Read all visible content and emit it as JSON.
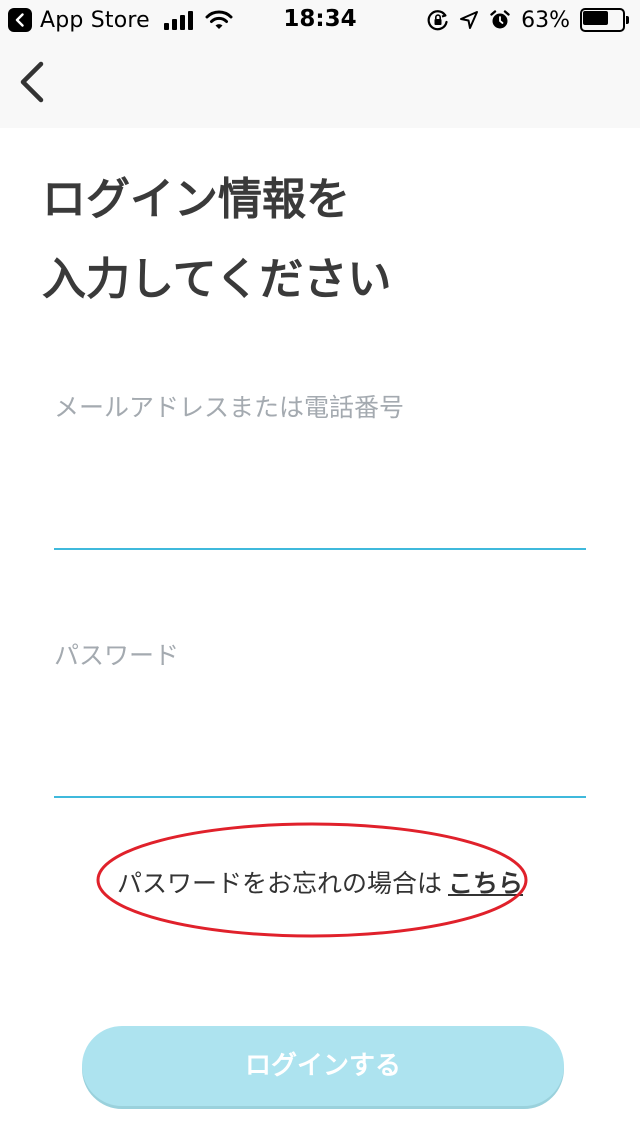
{
  "status_bar": {
    "back_app": "App Store",
    "time": "18:34",
    "battery_percent": "63%",
    "battery_level": 0.63
  },
  "nav": {
    "back_icon": "chevron-left-icon"
  },
  "heading": {
    "line1": "ログイン情報を",
    "line2": "入力してください"
  },
  "form": {
    "email": {
      "label": "メールアドレスまたは電話番号",
      "value": ""
    },
    "password": {
      "label": "パスワード",
      "value": ""
    }
  },
  "forgot": {
    "text": "パスワードをお忘れの場合は",
    "link": "こちら"
  },
  "login_button": {
    "label": "ログインする",
    "enabled": false
  },
  "colors": {
    "accent_line": "#3fb9dc",
    "button_disabled": "#ade3ef",
    "annotation_ellipse": "#e0212b"
  }
}
